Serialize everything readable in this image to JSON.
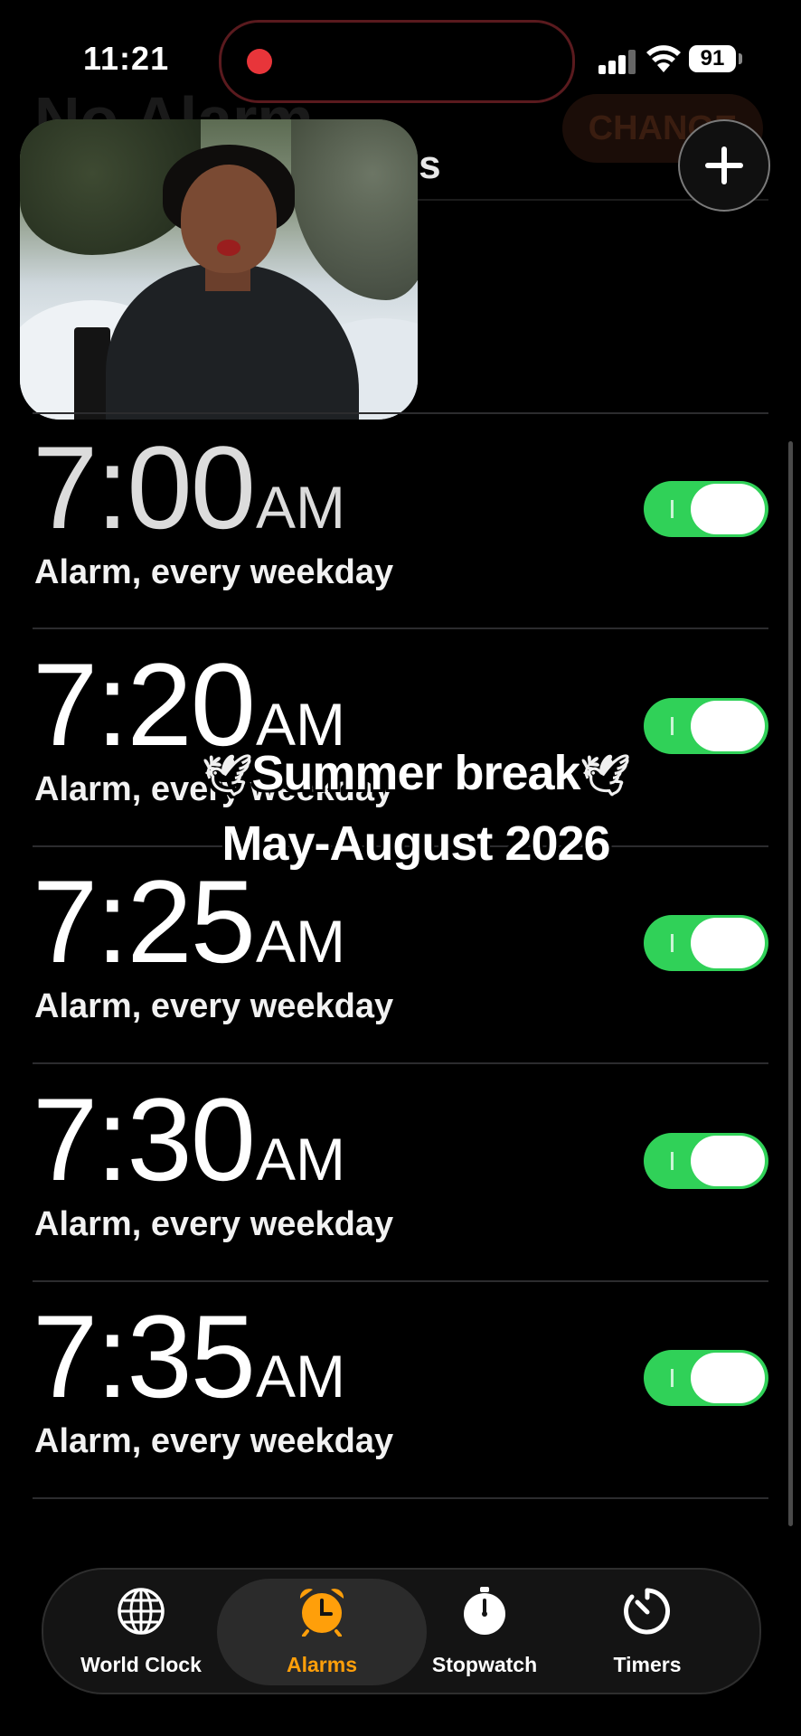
{
  "status_bar": {
    "time": "11:21",
    "battery": "91"
  },
  "header": {
    "ghost_title": "No Alarm",
    "ghost_button": "CHANGE",
    "section_title": "ms",
    "add_icon": "plus-icon"
  },
  "alarms": [
    {
      "time": "7:00",
      "ampm": "AM",
      "label": "Alarm, every weekday",
      "enabled": true
    },
    {
      "time": "7:20",
      "ampm": "AM",
      "label": "Alarm, every weekday",
      "enabled": true
    },
    {
      "time": "7:25",
      "ampm": "AM",
      "label": "Alarm, every weekday",
      "enabled": true
    },
    {
      "time": "7:30",
      "ampm": "AM",
      "label": "Alarm, every weekday",
      "enabled": true
    },
    {
      "time": "7:35",
      "ampm": "AM",
      "label": "Alarm, every weekday",
      "enabled": true
    }
  ],
  "caption": {
    "line1": "Summer break",
    "line2": "May-August 2026",
    "emoji": "🕊"
  },
  "tabs": [
    {
      "label": "World Clock",
      "icon": "globe-icon",
      "active": false
    },
    {
      "label": "Alarms",
      "icon": "alarm-clock-icon",
      "active": true
    },
    {
      "label": "Stopwatch",
      "icon": "stopwatch-icon",
      "active": false
    },
    {
      "label": "Timers",
      "icon": "timer-icon",
      "active": false
    }
  ],
  "colors": {
    "accent": "#ff9f0a",
    "toggle_on": "#30d158",
    "recording": "#e8353a"
  }
}
